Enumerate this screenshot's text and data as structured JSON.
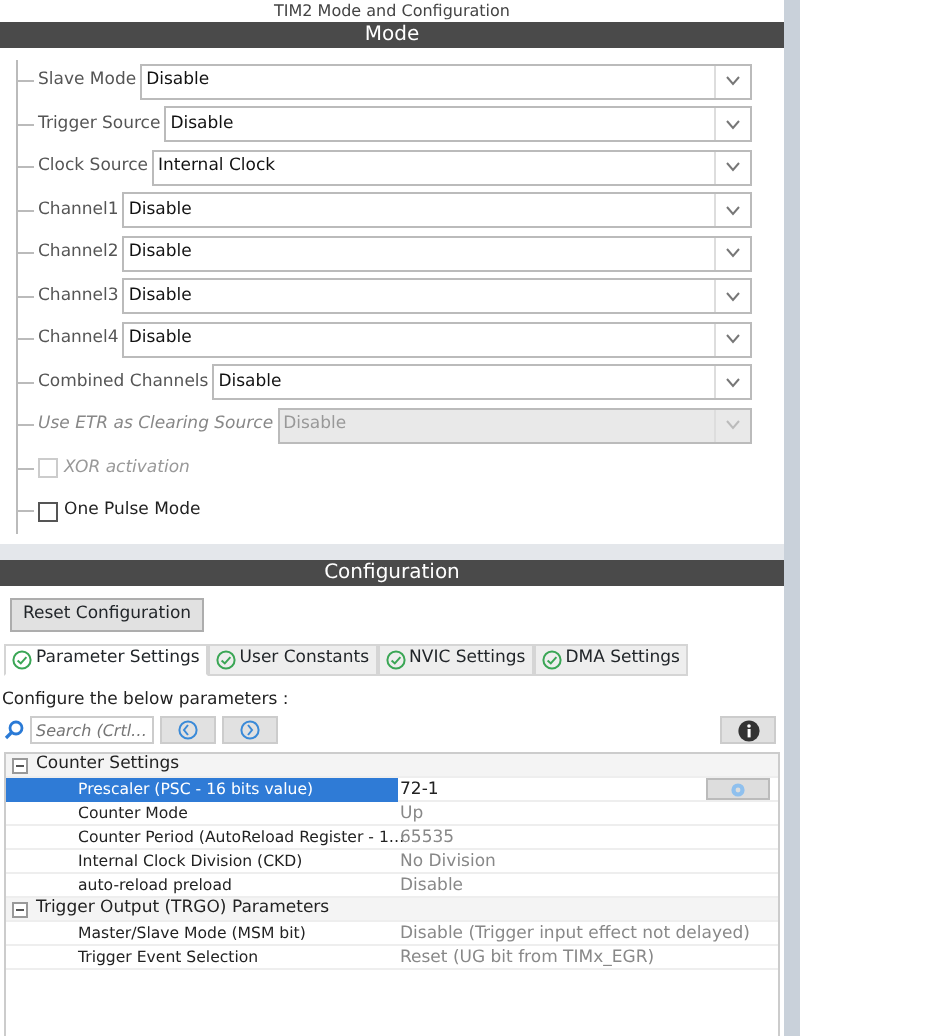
{
  "window": {
    "title": "TIM2 Mode and Configuration"
  },
  "mode": {
    "header": "Mode",
    "fields": [
      {
        "kind": "select",
        "label": "Slave Mode",
        "value": "Disable",
        "disabled": false
      },
      {
        "kind": "select",
        "label": "Trigger Source",
        "value": "Disable",
        "disabled": false
      },
      {
        "kind": "select",
        "label": "Clock Source",
        "value": "Internal Clock",
        "disabled": false
      },
      {
        "kind": "select",
        "label": "Channel1",
        "value": "Disable",
        "disabled": false
      },
      {
        "kind": "select",
        "label": "Channel2",
        "value": "Disable",
        "disabled": false
      },
      {
        "kind": "select",
        "label": "Channel3",
        "value": "Disable",
        "disabled": false
      },
      {
        "kind": "select",
        "label": "Channel4",
        "value": "Disable",
        "disabled": false
      },
      {
        "kind": "select",
        "label": "Combined Channels",
        "value": "Disable",
        "disabled": false
      },
      {
        "kind": "select",
        "label": "Use ETR as Clearing Source",
        "value": "Disable",
        "disabled": true
      },
      {
        "kind": "checkbox",
        "label": "XOR activation",
        "checked": false,
        "disabled": true
      },
      {
        "kind": "checkbox",
        "label": "One Pulse Mode",
        "checked": false,
        "disabled": false
      }
    ]
  },
  "configuration": {
    "header": "Configuration",
    "reset_button": "Reset Configuration",
    "tabs": [
      {
        "label": "Parameter Settings",
        "selected": true
      },
      {
        "label": "User Constants",
        "selected": false
      },
      {
        "label": "NVIC Settings",
        "selected": false
      },
      {
        "label": "DMA Settings",
        "selected": false
      }
    ],
    "description": "Configure the below parameters :",
    "search": {
      "placeholder": "Search (Crtl…"
    },
    "groups": [
      {
        "title": "Counter Settings",
        "expanded": true,
        "params": [
          {
            "name": "Prescaler (PSC - 16 bits value)",
            "value": "72-1",
            "selected": true
          },
          {
            "name": "Counter Mode",
            "value": "Up",
            "selected": false
          },
          {
            "name": "Counter Period (AutoReload Register - 1…",
            "value": "65535",
            "selected": false
          },
          {
            "name": "Internal Clock Division (CKD)",
            "value": "No Division",
            "selected": false
          },
          {
            "name": "auto-reload preload",
            "value": "Disable",
            "selected": false
          }
        ]
      },
      {
        "title": "Trigger Output (TRGO) Parameters",
        "expanded": true,
        "params": [
          {
            "name": "Master/Slave Mode (MSM bit)",
            "value": "Disable (Trigger input effect not delayed)",
            "selected": false
          },
          {
            "name": "Trigger Event Selection",
            "value": "Reset (UG bit from TIMx_EGR)",
            "selected": false
          }
        ]
      }
    ]
  }
}
